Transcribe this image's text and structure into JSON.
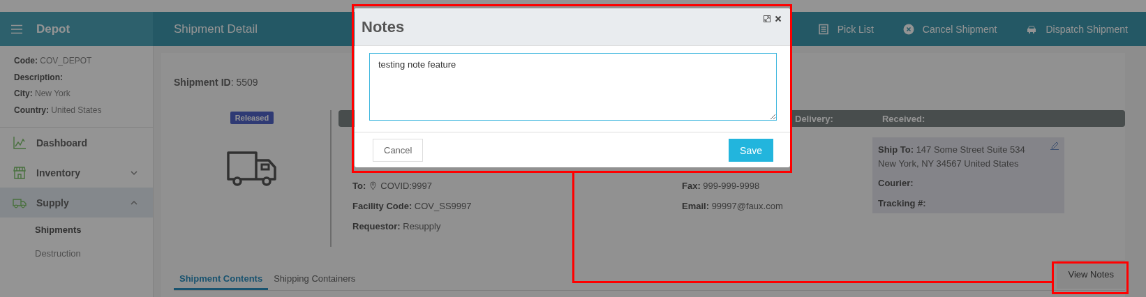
{
  "header": {
    "app_title": "Depot",
    "page_title": "Shipment Detail",
    "actions": [
      {
        "label": "Pick List"
      },
      {
        "label": "Cancel Shipment"
      },
      {
        "label": "Dispatch Shipment"
      }
    ]
  },
  "sidebar": {
    "info": [
      {
        "text": "**Code:** COV_DEPOT"
      },
      {
        "text": "**Description:**"
      },
      {
        "text": "**City:** New York"
      },
      {
        "text": "**Country:** United States"
      }
    ],
    "nav": [
      {
        "label": "Dashboard",
        "selected": false
      },
      {
        "label": "Inventory",
        "selected": false,
        "expanded": false
      },
      {
        "label": "Supply",
        "selected": true,
        "expanded": true,
        "children": [
          {
            "label": "Shipments",
            "selected": true
          },
          {
            "label": "Destruction",
            "selected": false
          }
        ]
      }
    ]
  },
  "shipment": {
    "id_text": "**Shipment ID**: 5509",
    "status": "Released",
    "status_bar": [
      "Delivery:",
      "Received:"
    ],
    "to": {
      "label": "To:",
      "value": "COVID:9997"
    },
    "fields_col1": [
      {
        "text": "**Facility Code:** COV_SS9997"
      },
      {
        "text": "**Requestor:** Resupply"
      }
    ],
    "fields_col3": [
      {
        "text": "**Fax:** 999-999-9998"
      },
      {
        "text": "**Email:** 99997@faux.com"
      }
    ],
    "ship_to": {
      "address": "**Ship To:** 147 Some Street Suite 534 New York, NY 34567 United States",
      "courier": "Courier:",
      "tracking": "Tracking #:"
    }
  },
  "tabs": [
    {
      "label": "Shipment Contents",
      "selected": true
    },
    {
      "label": "Shipping Containers",
      "selected": false
    }
  ],
  "view_notes": "View Notes",
  "modal": {
    "title": "Notes",
    "note": "testing note feature",
    "cancel": "Cancel",
    "save": "Save"
  }
}
